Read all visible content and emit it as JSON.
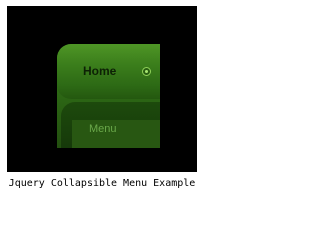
{
  "menu": {
    "home_label": "Home",
    "item_label": "Menu"
  },
  "caption": "Jquery Collapsible Menu Example",
  "icons": {
    "home_indicator": "radio-dot-icon"
  },
  "colors": {
    "frame": "#000000",
    "menu_green": "#3c7f1c",
    "submenu_green": "#1d4a0c",
    "label_light_green": "#6aa84a"
  }
}
